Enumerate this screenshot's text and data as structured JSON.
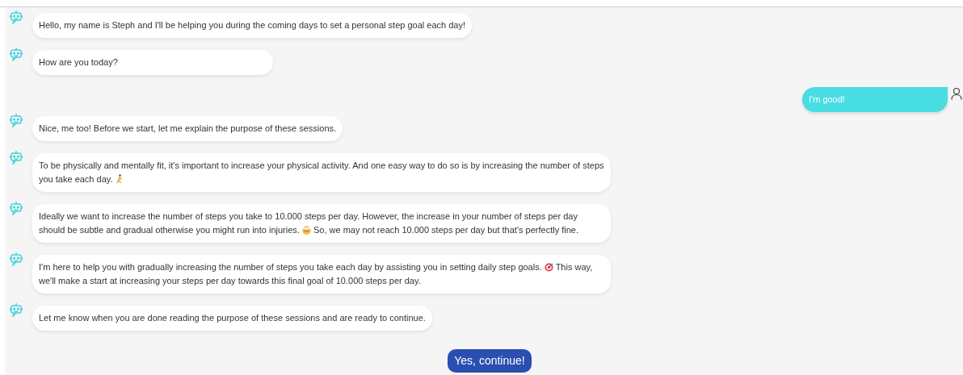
{
  "messages": [
    {
      "kind": "bot",
      "segments": [
        {
          "kind": "text",
          "text": "Hello, my name is Steph and I'll be helping you during the coming days to set a personal step goal each day!"
        }
      ]
    },
    {
      "kind": "bot",
      "segments": [
        {
          "kind": "text",
          "text": "How are you today?"
        }
      ]
    },
    {
      "kind": "user",
      "segments": [
        {
          "kind": "text",
          "text": "I'm good!"
        }
      ]
    },
    {
      "kind": "bot",
      "segments": [
        {
          "kind": "text",
          "text": "Nice, me too! Before we start, let me explain the purpose of these sessions."
        }
      ]
    },
    {
      "kind": "bot",
      "segments": [
        {
          "kind": "text",
          "text": "To be physically and mentally fit, it's important to increase your physical activity. And one easy way to do so is by increasing the number of steps you take each day. "
        },
        {
          "kind": "walker"
        }
      ]
    },
    {
      "kind": "bot",
      "segments": [
        {
          "kind": "text",
          "text": "Ideally we want to increase the number of steps you take to 10.000 steps per day. However, the increase in your number of steps per day should be subtle and gradual otherwise you might run into injuries. "
        },
        {
          "kind": "bandage"
        },
        {
          "kind": "text",
          "text": " So, we may not reach 10.000 steps per day but that's perfectly fine."
        }
      ]
    },
    {
      "kind": "bot",
      "segments": [
        {
          "kind": "text",
          "text": "I'm here to help you with gradually increasing the number of steps you take each day by assisting you in setting daily step goals. "
        },
        {
          "kind": "target"
        },
        {
          "kind": "text",
          "text": " This way, we'll make a start at increasing your steps per day towards this final goal of 10.000 steps per day."
        }
      ]
    },
    {
      "kind": "bot",
      "segments": [
        {
          "kind": "text",
          "text": "Let me know when you are done reading the purpose of these sessions and are ready to continue."
        }
      ]
    }
  ],
  "quick_reply": "Yes, continue!"
}
